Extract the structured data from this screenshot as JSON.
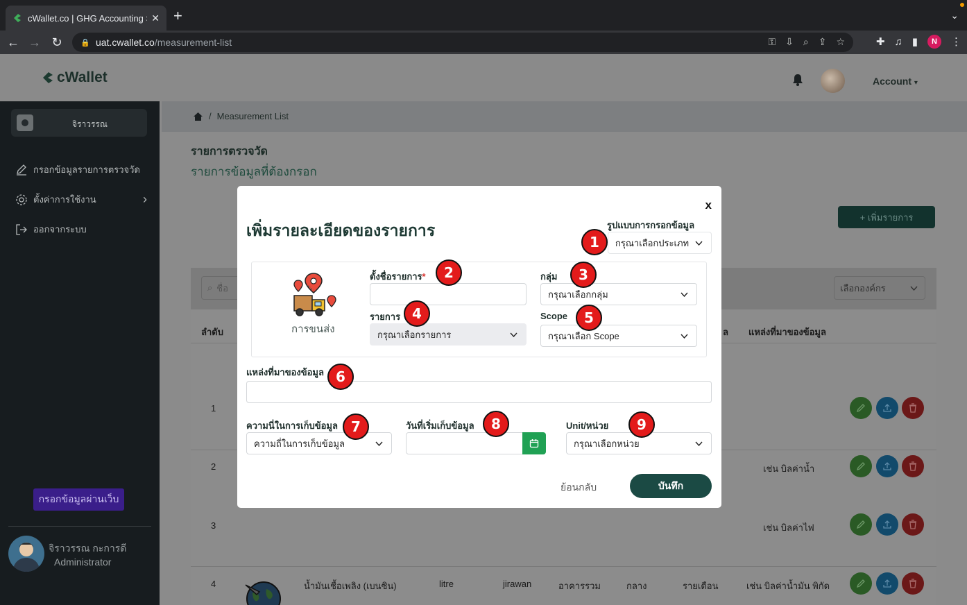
{
  "browser": {
    "tab_title": "cWallet.co | GHG Accounting S",
    "url_host": "uat.cwallet.co",
    "url_path": "/measurement-list",
    "profile_initial": "N"
  },
  "app": {
    "logo": "cWallet",
    "account_label": "Account",
    "sidebar": {
      "user_name": "จิราวรรณ",
      "items": [
        {
          "label": "กรอกข้อมูลรายการตรวจวัด"
        },
        {
          "label": "ตั้งค่าการใช้งาน"
        },
        {
          "label": "ออกจากระบบ"
        }
      ],
      "web_button": "กรอกข้อมูลผ่านเว็บ",
      "profile_name": "จิราวรรณ กะการดี",
      "profile_role": "Administrator"
    },
    "breadcrumb": "Measurement List",
    "page_title": "รายการตรวจวัด",
    "page_subtitle": "รายการข้อมูลที่ต้องกรอก",
    "add_button": "+ เพิ่มรายการ",
    "search_placeholder": "ชื่อ",
    "org_select": "เลือกองค์กร",
    "table": {
      "headers": {
        "index": "ลำดับ",
        "unit_partial": "ล",
        "source": "แหล่งที่มาของข้อมูล"
      },
      "rows": [
        {
          "index": "1",
          "name": "",
          "unit": "",
          "owner": "",
          "group": "",
          "scope": "",
          "freq": "",
          "source": ""
        },
        {
          "index": "2",
          "name": "",
          "unit": "",
          "owner": "",
          "group": "",
          "scope": "",
          "freq": "",
          "source": "เช่น บิลค่าน้ำ"
        },
        {
          "index": "3",
          "name": "",
          "unit": "",
          "owner": "",
          "group": "",
          "scope": "",
          "freq": "",
          "source": "เช่น บิลค่าไฟ"
        },
        {
          "index": "4",
          "name": "น้ำมันเชื้อเพลิง (เบนซิน)",
          "unit": "litre",
          "owner": "jirawan",
          "group": "อาคารรวม",
          "scope": "กลาง",
          "freq": "รายเดือน",
          "source": "เช่น บิลค่าน้ำมัน พิกัด"
        }
      ]
    }
  },
  "modal": {
    "close": "x",
    "title": "เพิ่มรายละเอียดของรายการ",
    "input_format_label": "รูปแบบการกรอกข้อมูล",
    "input_format_value": "กรุณาเลือกประเภท",
    "category_label": "การขนส่ง",
    "item_name_label": "ตั้งชื่อรายการ",
    "required_mark": "*",
    "item_name_value": "",
    "group_label": "กลุ่ม",
    "group_value": "กรุณาเลือกกลุ่ม",
    "item_label": "รายการ",
    "item_value": "กรุณาเลือกรายการ",
    "scope_label": "Scope",
    "scope_value": "กรุณาเลือก Scope",
    "source_label": "แหล่งที่มาของข้อมูล",
    "source_value": "",
    "frequency_label": "ความนี่ในการเก็บข้อมูล",
    "frequency_value": "ความถี่ในการเก็บข้อมูล",
    "start_date_label": "วันที่เริ่มเก็บข้อมูล",
    "start_date_value": "",
    "unit_label": "Unit/หน่วย",
    "unit_value": "กรุณาเลือกหน่วย",
    "back_button": "ย้อนกลับ",
    "save_button": "บันทึก"
  },
  "annotations": [
    "1",
    "2",
    "3",
    "4",
    "5",
    "6",
    "7",
    "8",
    "9"
  ],
  "colors": {
    "primary": "#1b4a44",
    "badge": "#e31b1b",
    "date_button": "#20a154",
    "sidebar_bg": "#171c1f"
  }
}
